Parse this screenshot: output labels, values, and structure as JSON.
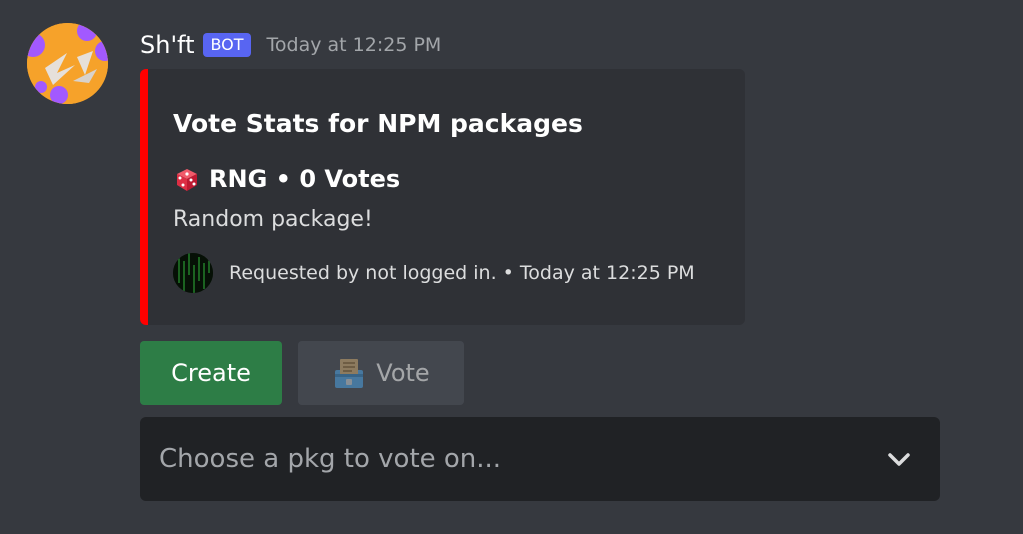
{
  "message": {
    "author": "Sh'ft",
    "bot_tag": "BOT",
    "timestamp": "Today at 12:25 PM"
  },
  "embed": {
    "accent_color": "#ff0000",
    "title": "Vote Stats for NPM packages",
    "field": {
      "icon": "game-die-icon",
      "name": "RNG • 0 Votes",
      "value": "Random package!"
    },
    "footer": {
      "icon": "requester-avatar-icon",
      "text": "Requested by not logged in. • Today at 12:25 PM"
    }
  },
  "buttons": {
    "create_label": "Create",
    "create_color": "#2d7d46",
    "vote_label": "Vote",
    "vote_icon": "ballot-box-icon",
    "vote_disabled": true
  },
  "select": {
    "placeholder": "Choose a pkg to vote on...",
    "icon": "chevron-down-icon"
  }
}
